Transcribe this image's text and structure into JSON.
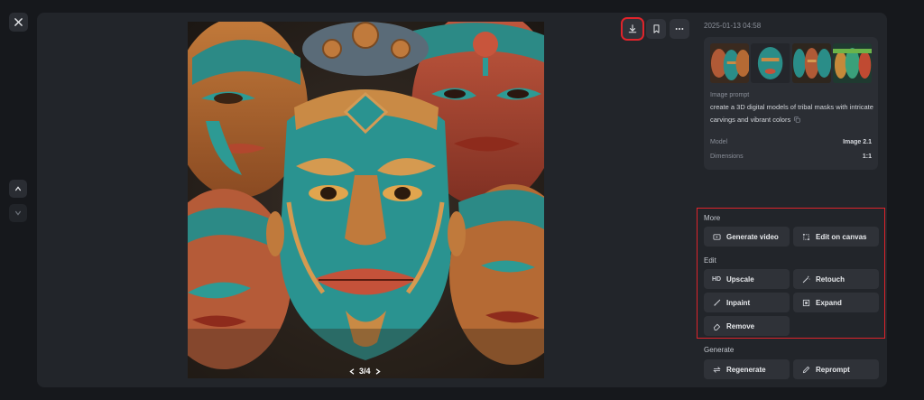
{
  "viewer": {
    "pager": "3/4",
    "timestamp": "2025-01-13 04:58"
  },
  "info": {
    "prompt_label": "Image prompt",
    "prompt_text": "create a 3D digital models of tribal masks with intricate carvings and vibrant colors",
    "model_label": "Model",
    "model_value": "Image 2.1",
    "dimensions_label": "Dimensions",
    "dimensions_value": "1:1"
  },
  "more": {
    "label": "More",
    "generate_video": "Generate video",
    "edit_on_canvas": "Edit on canvas"
  },
  "edit": {
    "label": "Edit",
    "upscale": "Upscale",
    "upscale_badge": "HD",
    "retouch": "Retouch",
    "inpaint": "Inpaint",
    "expand": "Expand",
    "remove": "Remove"
  },
  "generate": {
    "label": "Generate",
    "regenerate": "Regenerate",
    "reprompt": "Reprompt"
  },
  "colors": {
    "highlight": "#e0242b",
    "panel": "#22252a",
    "button": "#2f3238"
  }
}
